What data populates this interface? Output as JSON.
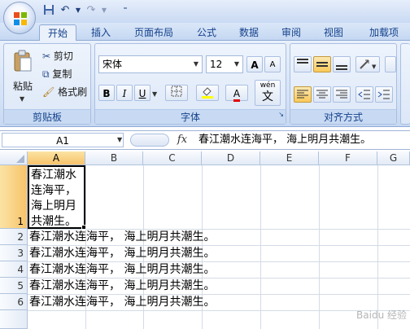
{
  "tabs": [
    "开始",
    "插入",
    "页面布局",
    "公式",
    "数据",
    "审阅",
    "视图",
    "加载项"
  ],
  "active_tab": "开始",
  "ribbon": {
    "clipboard": {
      "paste": "粘贴",
      "cut": "剪切",
      "copy": "复制",
      "format_painter": "格式刷",
      "label": "剪贴板"
    },
    "font": {
      "name": "宋体",
      "size": "12",
      "bold": "B",
      "italic": "I",
      "underline": "U",
      "color_a": "A",
      "phonetic": "wén",
      "phonetic_char": "文",
      "label": "字体",
      "grow": "A",
      "shrink": "A"
    },
    "alignment": {
      "label": "对齐方式"
    }
  },
  "formula_bar": {
    "name_box": "A1",
    "fx": "fx",
    "content": "春江潮水连海平， 海上明月共潮生。"
  },
  "columns": [
    "A",
    "B",
    "C",
    "D",
    "E",
    "F",
    "G"
  ],
  "rows": [
    {
      "num": "1",
      "text": "春江潮水\n连海平，\n海上明月\n共潮生。"
    },
    {
      "num": "2",
      "text": "春江潮水连海平， 海上明月共潮生。"
    },
    {
      "num": "3",
      "text": "春江潮水连海平， 海上明月共潮生。"
    },
    {
      "num": "4",
      "text": "春江潮水连海平， 海上明月共潮生。"
    },
    {
      "num": "5",
      "text": "春江潮水连海平， 海上明月共潮生。"
    },
    {
      "num": "6",
      "text": "春江潮水连海平， 海上明月共潮生。"
    }
  ],
  "a1_lines": [
    "春江潮水",
    "连海平，",
    "海上明月",
    "共潮生。"
  ],
  "watermark": "Baidu 经验"
}
